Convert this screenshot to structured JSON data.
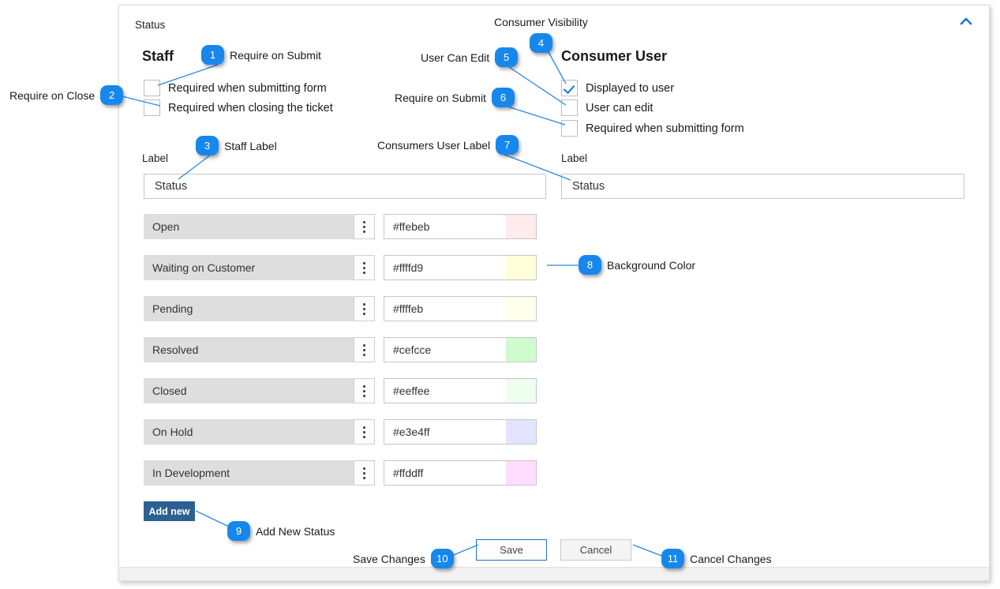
{
  "panel": {
    "section_title": "Status",
    "collapse_icon": "chevron-up-icon"
  },
  "staff": {
    "heading": "Staff",
    "checkboxes": [
      {
        "label": "Required when submitting form",
        "checked": false
      },
      {
        "label": "Required when closing the ticket",
        "checked": false
      }
    ],
    "label_caption": "Label",
    "label_value": "Status"
  },
  "consumer": {
    "heading": "Consumer User",
    "checkboxes": [
      {
        "label": "Displayed to user",
        "checked": true
      },
      {
        "label": "User can edit",
        "checked": false
      },
      {
        "label": "Required when submitting form",
        "checked": false
      }
    ],
    "label_caption": "Label",
    "label_value": "Status"
  },
  "statuses": [
    {
      "name": "Open",
      "hex": "#ffebeb",
      "swatch": "#ffebeb"
    },
    {
      "name": "Waiting on Customer",
      "hex": "#ffffd9",
      "swatch": "#ffffd9"
    },
    {
      "name": "Pending",
      "hex": "#ffffeb",
      "swatch": "#ffffeb"
    },
    {
      "name": "Resolved",
      "hex": "#cefcce",
      "swatch": "#cefcce"
    },
    {
      "name": "Closed",
      "hex": "#eeffee",
      "swatch": "#eeffee"
    },
    {
      "name": "On Hold",
      "hex": "#e3e4ff",
      "swatch": "#e3e4ff"
    },
    {
      "name": "In Development",
      "hex": "#ffddff",
      "swatch": "#ffddff"
    }
  ],
  "row_menu_icon": "kebab-menu-icon",
  "buttons": {
    "add_new": "Add new",
    "save": "Save",
    "cancel": "Cancel"
  },
  "annotations": [
    {
      "n": "1",
      "text": "Require on Submit"
    },
    {
      "n": "2",
      "text": "Require on Close"
    },
    {
      "n": "3",
      "text": "Staff Label"
    },
    {
      "n": "4",
      "text": "Consumer Visibility"
    },
    {
      "n": "5",
      "text": "User Can Edit"
    },
    {
      "n": "6",
      "text": "Require on Submit"
    },
    {
      "n": "7",
      "text": "Consumers User Label"
    },
    {
      "n": "8",
      "text": "Background Color"
    },
    {
      "n": "9",
      "text": "Add New Status"
    },
    {
      "n": "10",
      "text": "Save Changes"
    },
    {
      "n": "11",
      "text": "Cancel Changes"
    }
  ],
  "colors": {
    "badge": "#1787ec",
    "leader_line": "#2a8ae0",
    "add_new_button": "#2c6090",
    "save_border": "#1877d2",
    "row_background": "#dedede"
  }
}
